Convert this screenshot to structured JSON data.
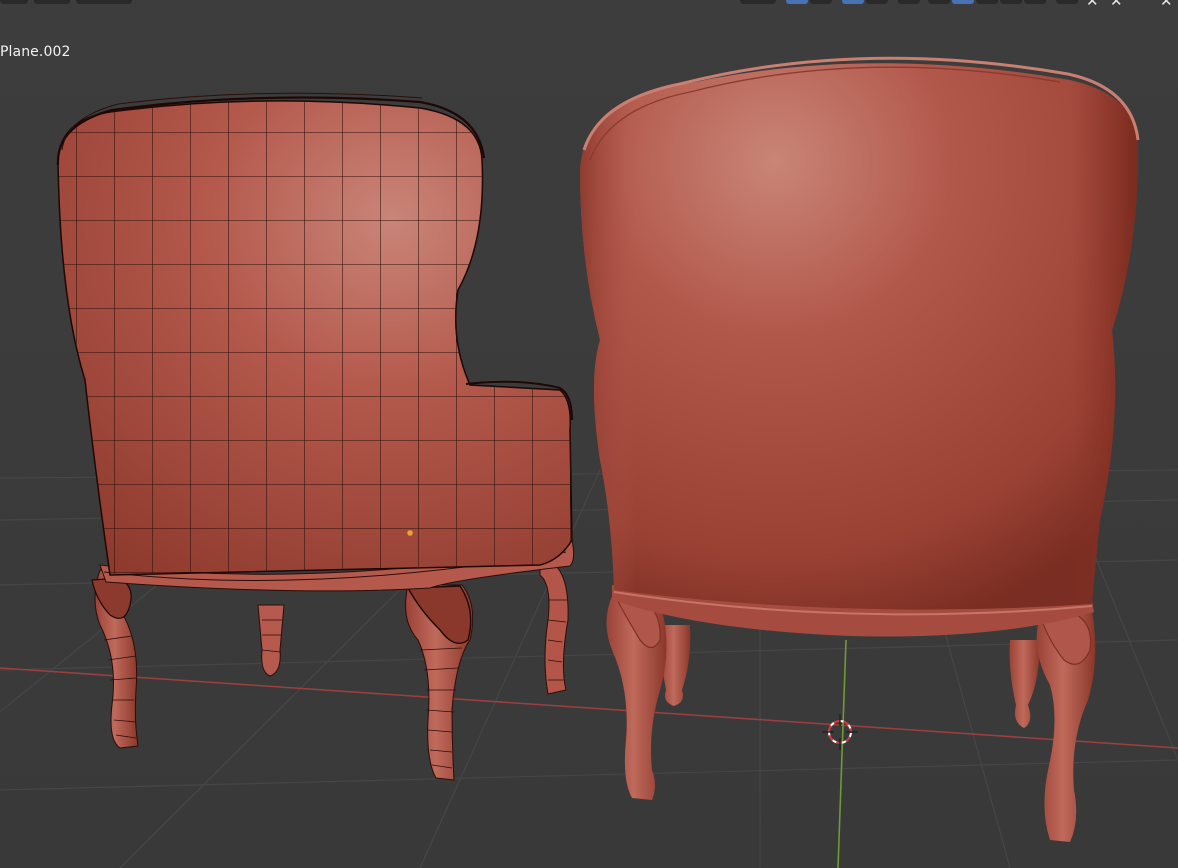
{
  "viewport": {
    "object_name": "Plane.002",
    "background_color": "#3b3b3b",
    "grid_color": "#444444",
    "x_axis_color": "#b54a4a",
    "y_axis_color": "#7aa43a",
    "mesh_color": "#b6584c",
    "wire_color": "#1f0a08"
  },
  "header": {
    "icons": [
      "tool-icon",
      "snap-icon",
      "proportional-edit-icon",
      "overlay-icon",
      "shading-wire-icon",
      "shading-solid-icon",
      "shading-material-icon",
      "shading-render-icon",
      "close-icon",
      "close-icon",
      "close-icon"
    ]
  },
  "scene": {
    "left_object": "wireframe-chair",
    "right_object": "smooth-chair",
    "cursor": "3d-cursor"
  }
}
